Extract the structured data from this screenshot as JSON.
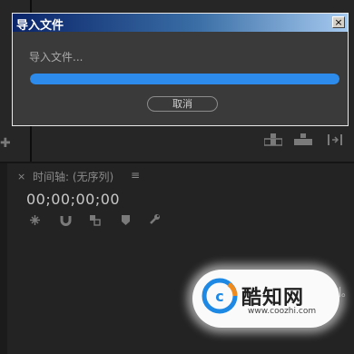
{
  "dialog": {
    "title": "导入文件",
    "close_glyph": "×",
    "message": "导入文件...",
    "progress": 1.0,
    "cancel_label": "取消"
  },
  "timeline": {
    "close_glyph": "×",
    "title": "时间轴: (无序列)",
    "menu_glyph": "≡",
    "timecode": "00;00;00;00"
  },
  "trailing_text": "列。",
  "watermark": {
    "title": "酷知网",
    "url": "www.coozhi.com"
  },
  "colors": {
    "progress": "#2d8ceb",
    "titlebar_start": "#0a246a",
    "titlebar_end": "#a6caf0"
  }
}
